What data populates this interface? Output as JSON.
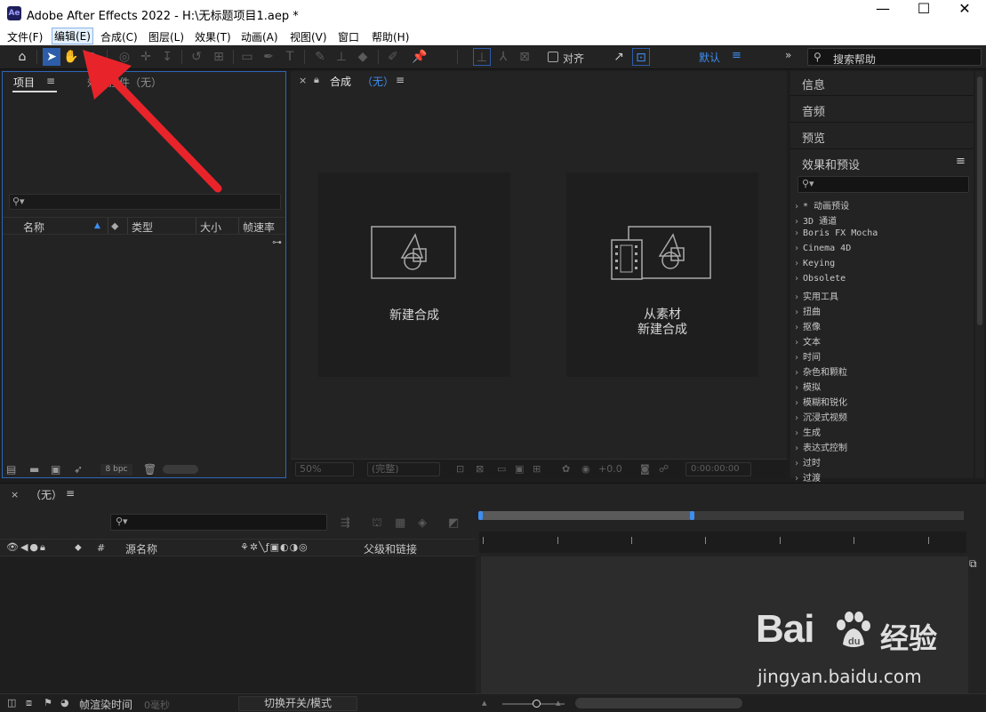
{
  "window": {
    "app_icon": "Ae",
    "title": "Adobe After Effects 2022 - H:\\无标题项目1.aep *",
    "minimize": "—",
    "maximize": "☐",
    "close": "✕"
  },
  "menu": {
    "items": [
      "文件(F)",
      "编辑(E)",
      "合成(C)",
      "图层(L)",
      "效果(T)",
      "动画(A)",
      "视图(V)",
      "窗口",
      "帮助(H)"
    ]
  },
  "toolbar": {
    "align_label": "对齐",
    "workspace_label": "默认",
    "workspace_menu": "≡",
    "expand": "»",
    "help_search_label": "搜索帮助",
    "icons": [
      "home-icon",
      "selection-tool-icon",
      "hand-tool-icon",
      "zoom-tool-icon",
      "orbit-camera-icon",
      "pan-camera-icon",
      "dolly-camera-icon",
      "rotation-tool-icon",
      "anchor-tool-icon",
      "rectangle-tool-icon",
      "pen-tool-icon",
      "type-tool-icon",
      "brush-tool-icon",
      "clone-stamp-icon",
      "eraser-tool-icon",
      "roto-brush-icon",
      "puppet-pin-icon"
    ]
  },
  "project_panel": {
    "tab_label": "项目",
    "tab_menu": "≡",
    "effects_controls_tab": "效果控件（无）",
    "columns": [
      "名称",
      "类型",
      "大小",
      "帧速率"
    ],
    "bpc": "8 bpc"
  },
  "composition_panel": {
    "close": "×",
    "tab_label": "合成",
    "tab_name": "（无）",
    "tab_menu": "≡",
    "new_comp_label": "新建合成",
    "from_footage_line1": "从素材",
    "from_footage_line2": "新建合成",
    "zoom_value": "50%",
    "resolution_value": "(完整)",
    "exposure_value": "+0.0",
    "timecode": "0:00:00:00"
  },
  "right_panels": {
    "tabs": [
      "信息",
      "音频",
      "预览",
      "效果和预设"
    ],
    "effects_menu": "≡",
    "effects_items": [
      "* 动画预设",
      "3D 通道",
      "Boris FX Mocha",
      "Cinema 4D",
      "Keying",
      "Obsolete",
      "实用工具",
      "扭曲",
      "抠像",
      "文本",
      "时间",
      "杂色和颗粒",
      "模拟",
      "模糊和锐化",
      "沉浸式视频",
      "生成",
      "表达式控制",
      "过时",
      "过渡"
    ]
  },
  "timeline": {
    "close": "×",
    "tab_label": "（无）",
    "tab_menu": "≡",
    "source_name_label": "源名称",
    "parent_label": "父级和链接",
    "number_label": "#",
    "render_time_label": "帧渲染时间",
    "render_time_value": "0毫秒",
    "toggle_label": "切换开关/模式"
  },
  "watermark": {
    "brand": "Bai",
    "brand_suffix": "du",
    "product": "经验",
    "url": "jingyan.baidu.com"
  },
  "colors": {
    "accent_blue": "#3d8ef2",
    "annotation_red": "#e8242a",
    "panel_bg": "#232323"
  }
}
